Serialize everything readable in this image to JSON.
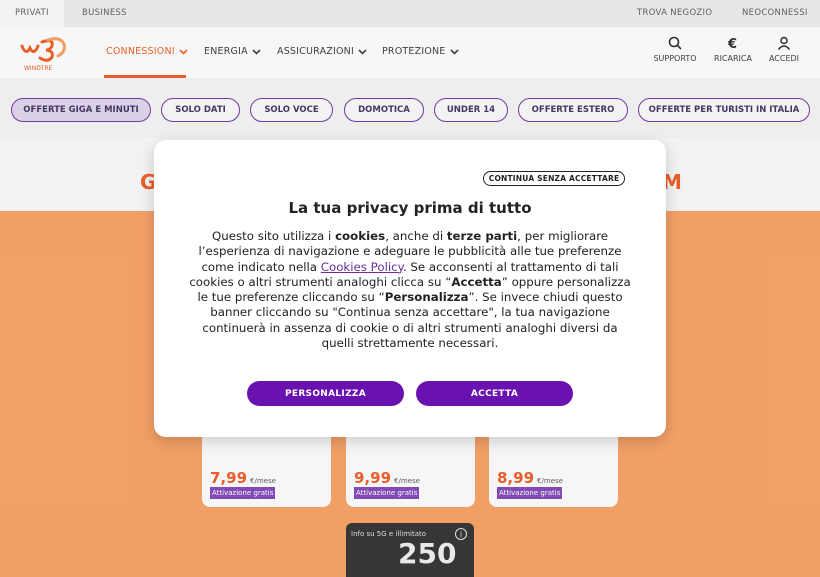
{
  "topbar": {
    "privati": "PRIVATI",
    "business": "BUSINESS",
    "trova_negozio": "TROVA NEGOZIO",
    "neoconnessi": "NEOCONNESSI"
  },
  "brand": {
    "logo_text": "WINDTRE",
    "accent": "#e8541b",
    "purple": "#6a12b0"
  },
  "nav": {
    "items": [
      {
        "label": "CONNESSIONI"
      },
      {
        "label": "ENERGIA"
      },
      {
        "label": "ASSICURAZIONI"
      },
      {
        "label": "PROTEZIONE"
      }
    ],
    "right": [
      {
        "label": "SUPPORTO",
        "icon": "search-icon"
      },
      {
        "label": "RICARICA",
        "icon": "euro-icon"
      },
      {
        "label": "ACCEDI",
        "icon": "user-icon"
      }
    ]
  },
  "chips": [
    {
      "label": "OFFERTE GIGA E MINUTI",
      "selected": true
    },
    {
      "label": "SOLO DATI"
    },
    {
      "label": "SOLO VOCE"
    },
    {
      "label": "DOMOTICA"
    },
    {
      "label": "UNDER 14"
    },
    {
      "label": "OFFERTE ESTERO"
    },
    {
      "label": "OFFERTE PER TURISTI IN ITALIA"
    }
  ],
  "cards": [
    {
      "price": "7,99",
      "unit": "€/mese",
      "badge": "Attivazione gratis"
    },
    {
      "price": "9,99",
      "unit": "€/mese",
      "badge": "Attivazione gratis"
    },
    {
      "price": "8,99",
      "unit": "€/mese",
      "badge": "Attivazione gratis"
    }
  ],
  "video": {
    "caption": "Info su 5G e illimitato",
    "big": "250",
    "info": "i"
  },
  "modal": {
    "skip": "CONTINUA SENZA ACCETTARE",
    "title": "La tua privacy prima di tutto",
    "body": {
      "p1": "Questo sito utilizza i ",
      "b1": "cookies",
      "p2": ", anche di ",
      "b2": "terze parti",
      "p3": ", per migliorare l’esperienza di navigazione e adeguare le pubblicità alle tue preferenze come indicato nella ",
      "link": "Cookies Policy",
      "p4": ". Se acconsenti al trattamento di tali cookies o altri strumenti analoghi clicca su “",
      "b3": "Accetta",
      "p5": "” oppure personalizza le tue preferenze cliccando su “",
      "b4": "Personalizza",
      "p6": "”. Se invece chiudi questo banner cliccando su \"Continua senza accettare\", la tua navigazione continuerà in assenza di cookie o di altri strumenti analoghi diversi da quelli strettamente necessari."
    },
    "personalizza": "PERSONALIZZA",
    "accetta": "ACCETTA"
  }
}
